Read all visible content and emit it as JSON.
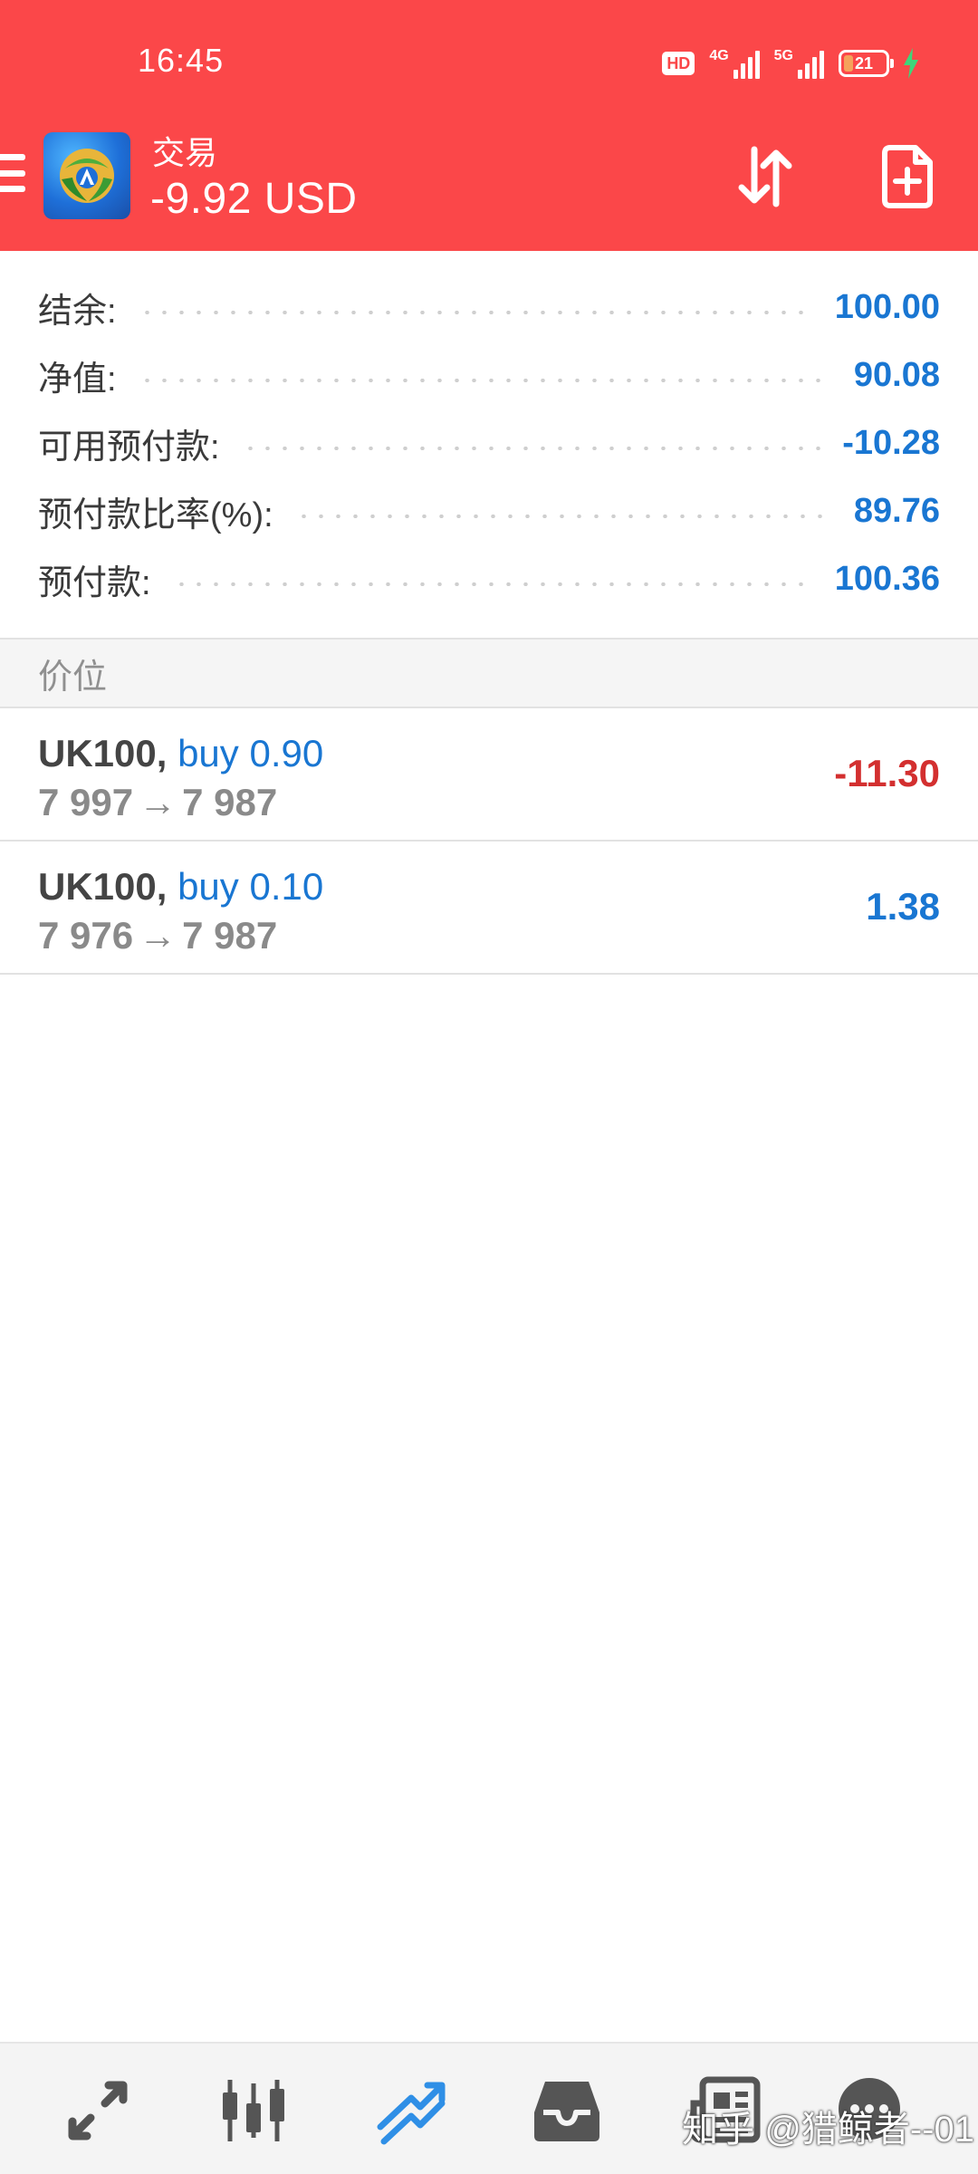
{
  "status_bar": {
    "time": "16:45",
    "hd_label": "HD",
    "net1": "4G",
    "net2": "5G",
    "battery": "21"
  },
  "header": {
    "title": "交易",
    "balance": "-9.92 USD",
    "background": "#fb4749"
  },
  "summary": [
    {
      "label": "结余:",
      "value": "100.00"
    },
    {
      "label": "净值:",
      "value": "90.08"
    },
    {
      "label": "可用预付款:",
      "value": "-10.28"
    },
    {
      "label": "预付款比率(%):",
      "value": "89.76"
    },
    {
      "label": "预付款:",
      "value": "100.36"
    }
  ],
  "section_title": "价位",
  "positions": [
    {
      "symbol": "UK100,",
      "side": "buy 0.90",
      "open_price": "7 997",
      "current_price": "7 987",
      "arrow": "→",
      "profit": "-11.30",
      "profit_color": "#d32f2f"
    },
    {
      "symbol": "UK100,",
      "side": "buy 0.10",
      "open_price": "7 976",
      "current_price": "7 987",
      "arrow": "→",
      "profit": "1.38",
      "profit_color": "#1976d2"
    }
  ],
  "bottom_nav": [
    {
      "icon": "quotes-icon"
    },
    {
      "icon": "chart-icon"
    },
    {
      "icon": "trade-icon",
      "active": true
    },
    {
      "icon": "history-icon"
    },
    {
      "icon": "news-icon"
    },
    {
      "icon": "messages-icon"
    }
  ],
  "watermark": "知乎 @猎鲸者--01",
  "colors": {
    "accent_blue": "#1976d2",
    "loss_red": "#d32f2f",
    "nav_icon": "#555555",
    "nav_active": "#2f8fe6"
  }
}
